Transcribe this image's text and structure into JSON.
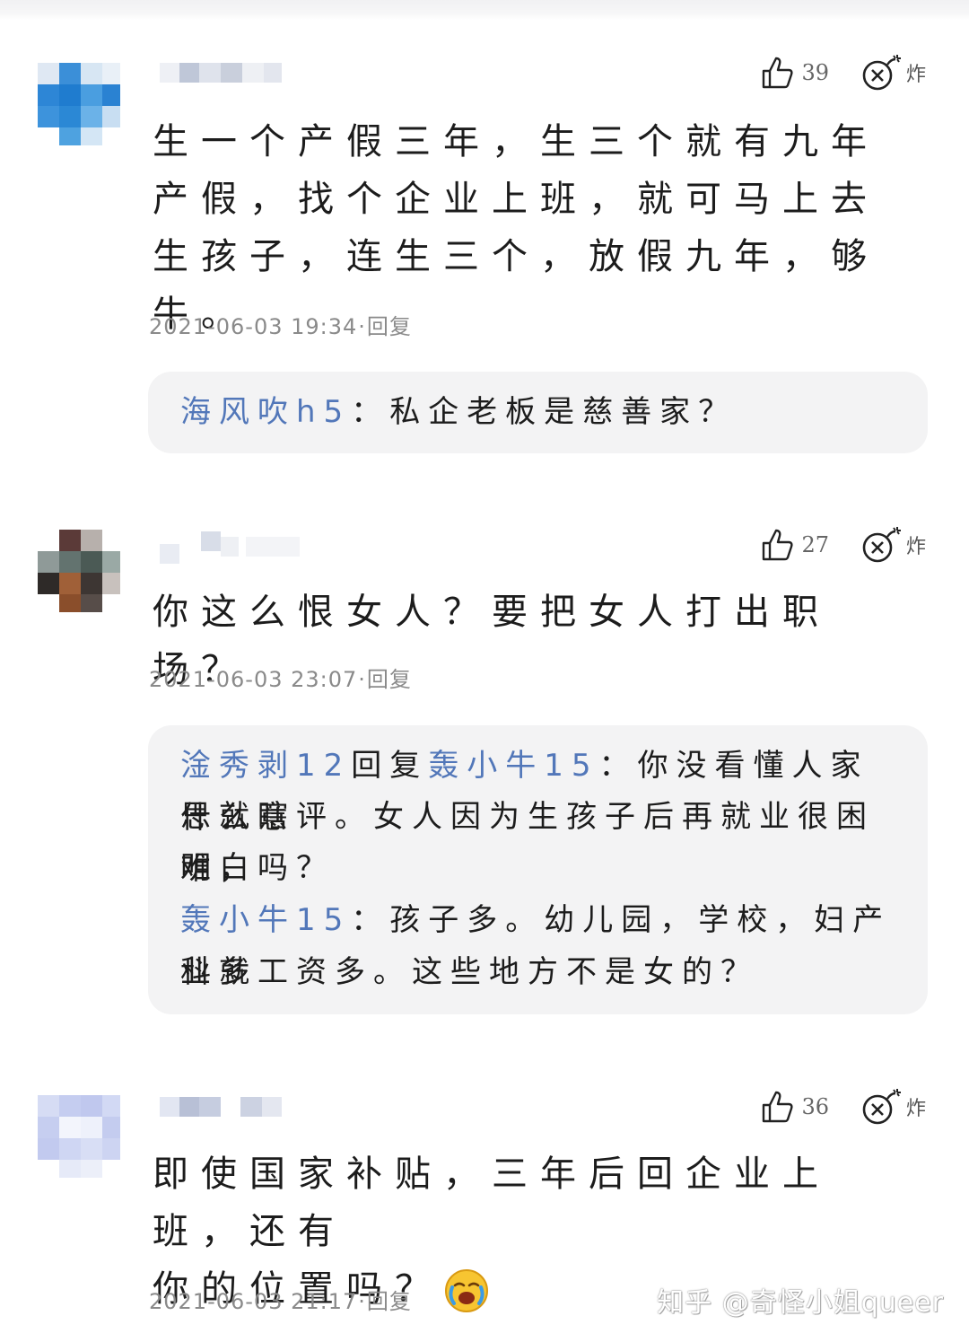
{
  "comments": [
    {
      "likes": "39",
      "bomb_label": "炸",
      "text": "生一个产假三年，生三个就有九年产假，找个企业上班，就可马上去生孩子，连生三个，放假九年，够牛。",
      "timestamp": "2021-06-03 19:34",
      "reply_label": "回复",
      "replies": [
        {
          "name": "海风吹h5",
          "sep": "：",
          "text": "私企老板是慈善家？"
        }
      ]
    },
    {
      "likes": "27",
      "bomb_label": "炸",
      "text": "你这么恨女人？要把女人打出职场？",
      "timestamp": "2021-06-03 23:07",
      "reply_label": "回复",
      "replies": [
        {
          "name": "淦秀剥12",
          "mid": "回复",
          "target": "轰小牛15",
          "sep": "：",
          "text_line1": "你没看懂人家什么意",
          "text_line2": "思就瞎评。女人因为生孩子后再就业很困难，",
          "text_line3": "明白吗？"
        },
        {
          "name": "轰小牛15",
          "sep": "：",
          "text_line1": "孩子多。幼儿园，学校，妇产科就",
          "text_line2": "业多工资多。这些地方不是女的？"
        }
      ]
    },
    {
      "likes": "36",
      "bomb_label": "炸",
      "text_line1": "即使国家补贴，三年后回企业上班，还有",
      "text_line2": "你的位置吗？",
      "emoji": "crying-face",
      "timestamp": "2021-06-03 21:17",
      "reply_label": "回复"
    }
  ],
  "watermark": "知乎 @奇怪小姐queer",
  "colors": {
    "reply_name": "#5277b9",
    "reply_bg": "#f3f3f4",
    "meta": "#8a8a8a"
  }
}
